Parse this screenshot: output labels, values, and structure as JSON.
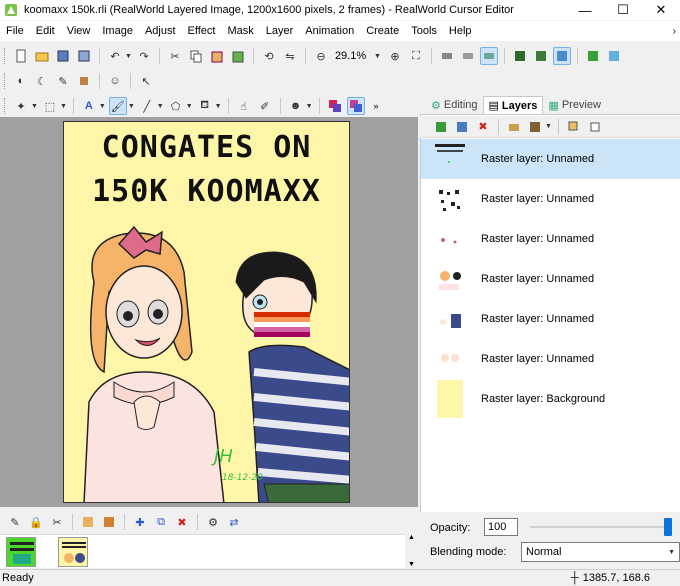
{
  "window": {
    "title": "koomaxx 150k.rli (RealWorld Layered Image, 1200x1600 pixels, 2 frames) - RealWorld Cursor Editor",
    "minimize": "—",
    "maximize": "☐",
    "close": "✕"
  },
  "menu": {
    "items": [
      "File",
      "Edit",
      "View",
      "Image",
      "Adjust",
      "Effect",
      "Mask",
      "Layer",
      "Animation",
      "Create",
      "Tools",
      "Help"
    ],
    "overflow": "›"
  },
  "toolbar1": {
    "zoom_value": "29.1%"
  },
  "canvas": {
    "line1": "CONGATES ON",
    "line2": "150K KOOMAXX",
    "signature": "JH",
    "date": "18-12-20"
  },
  "panel": {
    "tabs": [
      "Editing",
      "Layers",
      "Preview"
    ],
    "active_tab": "Layers"
  },
  "layers": [
    {
      "name": "Raster layer: Unnamed"
    },
    {
      "name": "Raster layer: Unnamed"
    },
    {
      "name": "Raster layer: Unnamed"
    },
    {
      "name": "Raster layer: Unnamed"
    },
    {
      "name": "Raster layer: Unnamed"
    },
    {
      "name": "Raster layer: Unnamed"
    },
    {
      "name": "Raster layer: Background"
    }
  ],
  "layer_props": {
    "opacity_label": "Opacity:",
    "opacity_value": "100",
    "opacity_level": 1.0,
    "blend_label": "Blending mode:",
    "blend_value": "Normal"
  },
  "status": {
    "text": "Ready",
    "coords": "1385.7, 168.6"
  },
  "colors": {
    "accent": "#0a74d8",
    "selection": "#cce4f7",
    "canvas_bg": "#fdf6a8"
  }
}
